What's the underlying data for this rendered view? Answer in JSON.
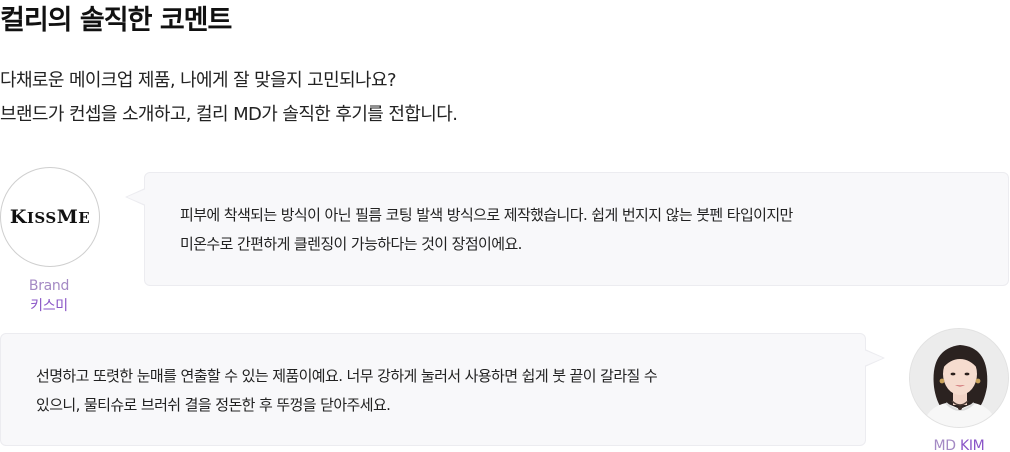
{
  "page": {
    "title": "컬리의 솔직한 코멘트",
    "intro": [
      "다채로운 메이크업 제품, 나에게 잘 맞을지 고민되나요?",
      "브랜드가 컨셉을 소개하고, 컬리 MD가 솔직한 후기를 전합니다."
    ]
  },
  "brand_comment": {
    "logo": {
      "k": "K",
      "iss": "ISS",
      "m": "M",
      "e": "E"
    },
    "role": "Brand",
    "name": "키스미",
    "lines": [
      "피부에 착색되는 방식이 아닌 필름 코팅 발색 방식으로 제작했습니다. 쉽게 번지지 않는 붓펜 타입이지만",
      "미온수로 간편하게 클렌징이 가능하다는 것이 장점이에요."
    ]
  },
  "md_comment": {
    "caption_role": "MD",
    "caption_name": "KIM",
    "lines": [
      "선명하고 또렷한 눈매를 연출할 수 있는 제품이예요. 너무 강하게 눌러서 사용하면 쉽게 붓 끝이 갈라질 수",
      "있으니, 물티슈로 브러쉬 결을 정돈한 후 뚜껑을 닫아주세요."
    ],
    "photo_icon": "md-portrait"
  },
  "colors": {
    "accent_purple": "#8a55c7",
    "bubble_bg": "#f8f8fa",
    "text": "#222222"
  }
}
